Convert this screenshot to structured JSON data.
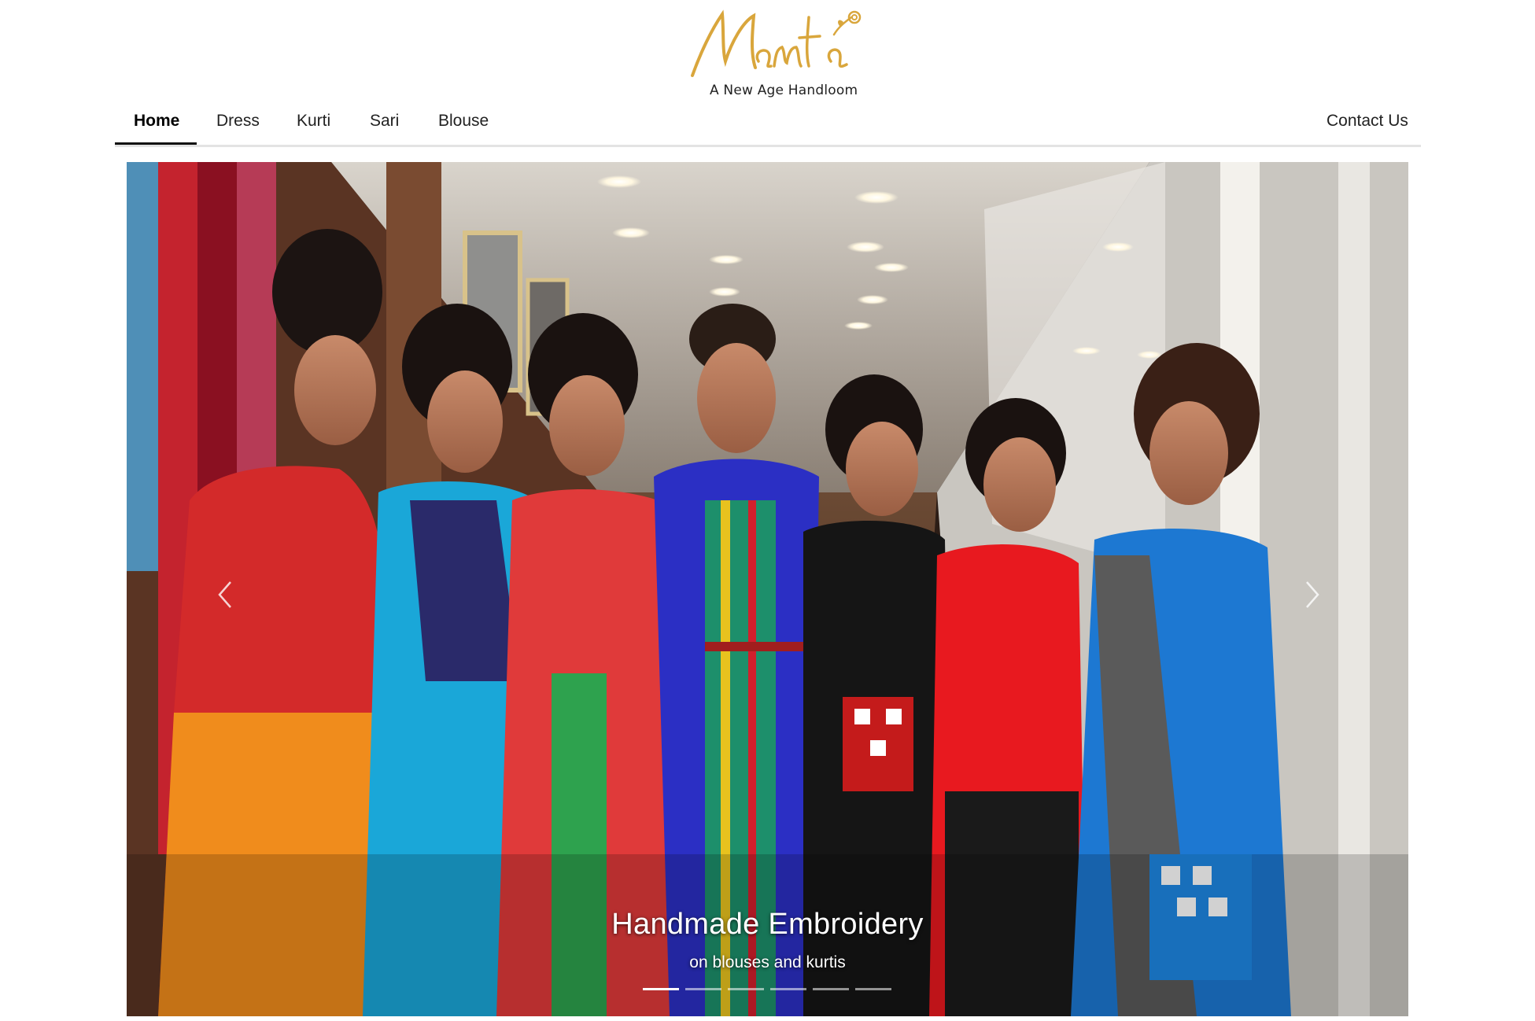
{
  "brand": {
    "logo_script": "Mamta",
    "tagline": "A New Age Handloom",
    "gold": "#d9a63c"
  },
  "nav": {
    "left_items": [
      {
        "label": "Home",
        "active": true
      },
      {
        "label": "Dress",
        "active": false
      },
      {
        "label": "Kurti",
        "active": false
      },
      {
        "label": "Sari",
        "active": false
      },
      {
        "label": "Blouse",
        "active": false
      }
    ],
    "right_item": {
      "label": "Contact Us"
    }
  },
  "carousel": {
    "prev_icon": "chevron-left-icon",
    "next_icon": "chevron-right-icon",
    "caption_title": "Handmade Embroidery",
    "caption_subtitle": "on blouses and kurtis",
    "slide_count": 6,
    "active_slide": 1
  }
}
